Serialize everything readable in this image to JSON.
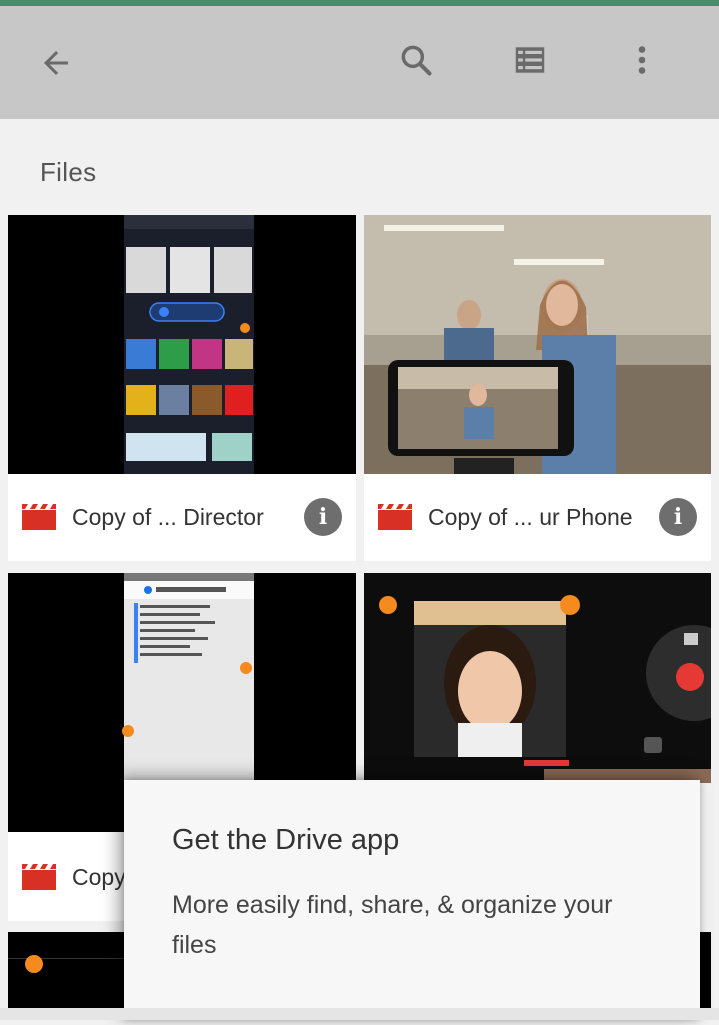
{
  "appbar": {
    "back_icon": "arrow-left-icon",
    "search_icon": "search-icon",
    "view_icon": "list-view-icon",
    "more_icon": "more-vert-icon"
  },
  "section": {
    "title": "Files"
  },
  "files": [
    {
      "name": "Copy of ... Director",
      "icon": "video-file-icon",
      "info_glyph": "i"
    },
    {
      "name": "Copy of ... ur Phone",
      "icon": "video-file-icon",
      "info_glyph": "i"
    },
    {
      "name": "Copy",
      "icon": "video-file-icon"
    }
  ],
  "promo": {
    "title": "Get the Drive app",
    "text": "More easily find, share, & organize your files"
  },
  "colors": {
    "topline": "#4a8c6a",
    "appbar": "#c7c7c7",
    "video_icon": "#d93025",
    "info_button": "#6e6e6e"
  }
}
